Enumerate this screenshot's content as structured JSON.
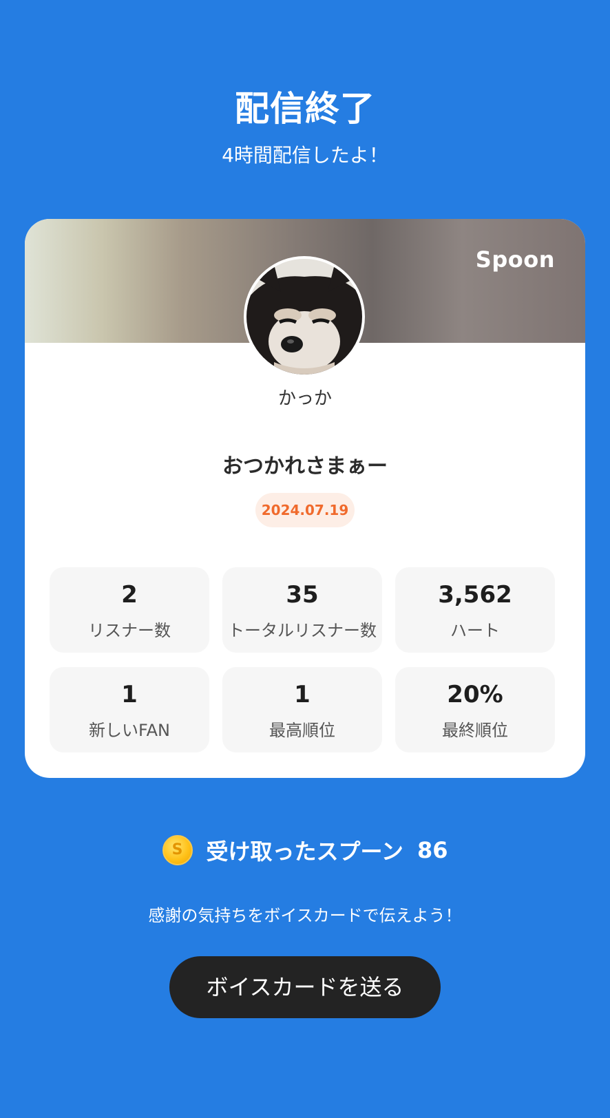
{
  "header": {
    "title": "配信終了",
    "subtitle": "4時間配信したよ！"
  },
  "card": {
    "brand": "Spoon",
    "username": "かっか",
    "broadcast_title": "おつかれさまぁー",
    "date": "2024.07.19",
    "stats": [
      {
        "value": "2",
        "label": "リスナー数"
      },
      {
        "value": "35",
        "label": "トータルリスナー数"
      },
      {
        "value": "3,562",
        "label": "ハート"
      },
      {
        "value": "1",
        "label": "新しいFAN"
      },
      {
        "value": "1",
        "label": "最高順位"
      },
      {
        "value": "20%",
        "label": "最終順位"
      }
    ]
  },
  "spoons": {
    "coin_letter": "S",
    "label": "受け取ったスプーン",
    "count": "86"
  },
  "thanks_text": "感謝の気持ちをボイスカードで伝えよう！",
  "send_button_label": "ボイスカードを送る",
  "colors": {
    "background": "#257de2",
    "card": "#ffffff",
    "date_badge_bg": "#fdeee6",
    "date_badge_text": "#f06a2c",
    "button": "#232323"
  }
}
